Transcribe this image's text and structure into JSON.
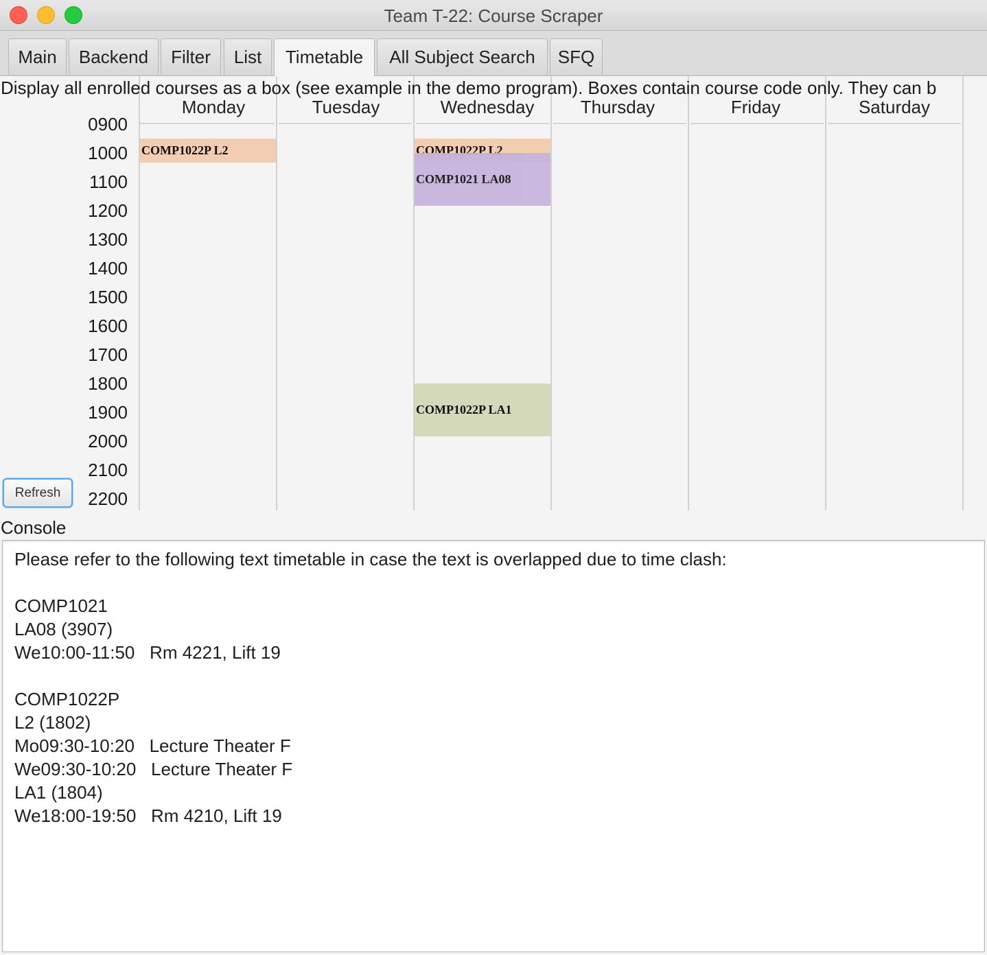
{
  "window": {
    "title": "Team T-22: Course Scraper"
  },
  "tabs": [
    {
      "label": "Main"
    },
    {
      "label": "Backend"
    },
    {
      "label": "Filter"
    },
    {
      "label": "List"
    },
    {
      "label": "Timetable",
      "active": true
    },
    {
      "label": "All Subject Search"
    },
    {
      "label": "SFQ"
    }
  ],
  "timetable": {
    "description": "Display all enrolled courses as a box (see example in the demo program). Boxes contain course code only. They can b",
    "days": [
      "Monday",
      "Tuesday",
      "Wednesday",
      "Thursday",
      "Friday",
      "Saturday"
    ],
    "hours": [
      "0900",
      "1000",
      "1100",
      "1200",
      "1300",
      "1400",
      "1500",
      "1600",
      "1700",
      "1800",
      "1900",
      "2000",
      "2100",
      "2200"
    ],
    "blocks": [
      {
        "label": "COMP1022P L2",
        "day": "Monday",
        "start": "09:30",
        "end": "10:20",
        "color": "#f2cdb1"
      },
      {
        "label": "COMP1022P L2",
        "day": "Wednesday",
        "start": "09:30",
        "end": "10:20",
        "color": "#f2cdb1"
      },
      {
        "label": "COMP1021 LA08",
        "day": "Wednesday",
        "start": "10:00",
        "end": "11:50",
        "color": "#c6b2dd"
      },
      {
        "label": "COMP1022P LA1",
        "day": "Wednesday",
        "start": "18:00",
        "end": "19:50",
        "color": "#d3d9b9"
      }
    ],
    "refresh_label": "Refresh"
  },
  "console": {
    "label": "Console",
    "lines": [
      "Please refer to the following text timetable in case the text is overlapped due to time clash:",
      "",
      "COMP1021",
      "LA08 (3907)",
      "We10:00-11:50   Rm 4221, Lift 19",
      "",
      "COMP1022P",
      "L2 (1802)",
      "Mo09:30-10:20   Lecture Theater F",
      "We09:30-10:20   Lecture Theater F",
      "LA1 (1804)",
      "We18:00-19:50   Rm 4210, Lift 19"
    ]
  }
}
